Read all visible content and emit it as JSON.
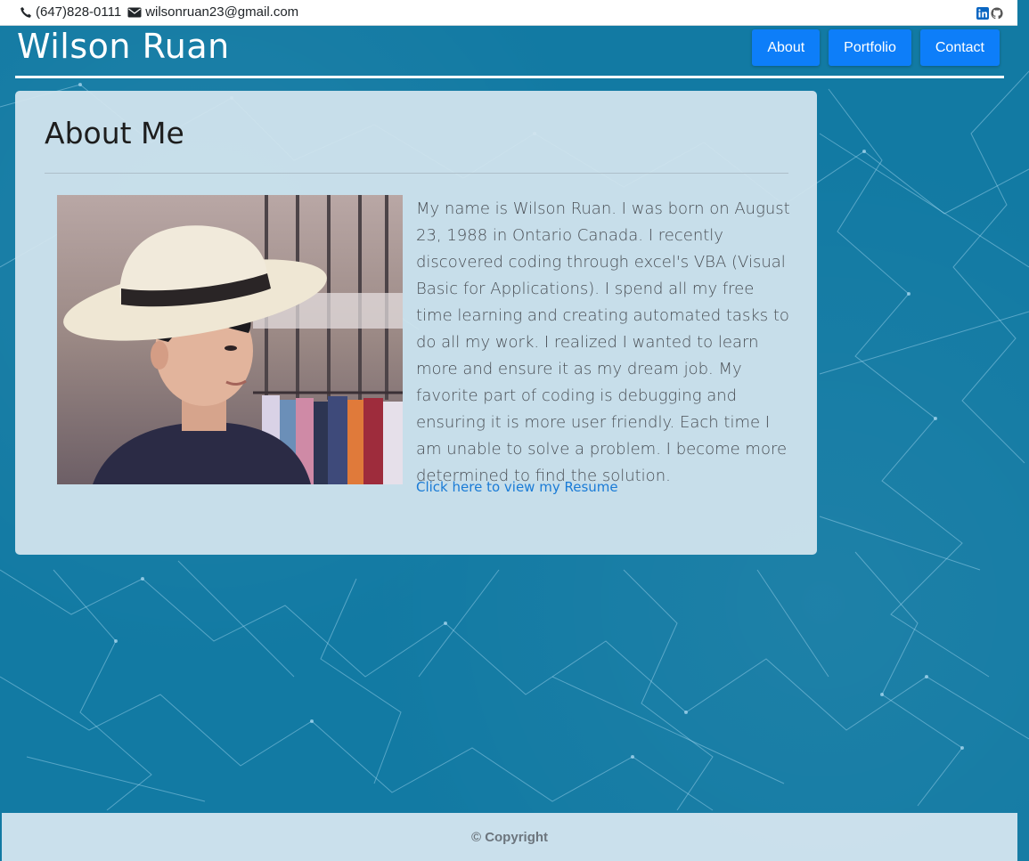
{
  "topbar": {
    "phone_icon": "phone-icon",
    "phone": "(647)828-0111",
    "email_icon": "envelope-icon",
    "email": "wilsonruan23@gmail.com",
    "social_icons": [
      "linkedin-icon",
      "github-icon"
    ]
  },
  "header": {
    "title": "Wilson Ruan",
    "nav": [
      {
        "label": "About"
      },
      {
        "label": "Portfolio"
      },
      {
        "label": "Contact"
      }
    ]
  },
  "about": {
    "heading": "About Me",
    "bio": "My name is Wilson Ruan. I was born on August 23, 1988 in Ontario Canada. I recently discovered coding through excel's VBA (Visual Basic for Applications). I spend all my free time learning and creating automated tasks to do all my work. I realized I wanted to learn more and ensure it as my dream job. My favorite part of coding is debugging and ensuring it is more user friendly. Each time I am unable to solve a problem. I become more determined to find the solution.",
    "resume_link": "Click here to view my Resume"
  },
  "footer": {
    "copyright": "© Copyright"
  },
  "colors": {
    "background": "#127aa3",
    "nav_button": "#0d7ef9",
    "card": "#d2e4ee",
    "link": "#1a7bd6"
  }
}
